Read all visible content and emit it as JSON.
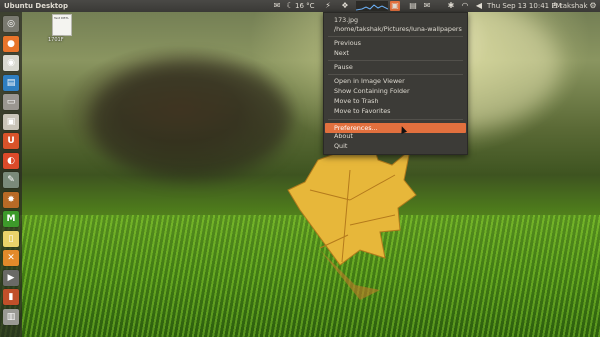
{
  "panel": {
    "title": "Ubuntu Desktop",
    "weather": "16 °C",
    "clock": "Thu Sep 13 10:41 PM",
    "user": "takshak",
    "icons": [
      "mail-icon",
      "cloud-icon",
      "lightning-icon",
      "dropbox-icon",
      "network-monitor-icon",
      "wallpaper-changer-icon",
      "chat-icon",
      "messaging-icon",
      "wifi-icon",
      "volume-icon",
      "settings-icon"
    ]
  },
  "launcher": {
    "items": [
      {
        "name": "dash-home-icon",
        "glyph": "◎",
        "color": "#7a7a70"
      },
      {
        "name": "firefox-icon",
        "glyph": "●",
        "color": "#e8742a"
      },
      {
        "name": "chromium-icon",
        "glyph": "◉",
        "color": "#d9d9d0"
      },
      {
        "name": "libreoffice-writer-icon",
        "glyph": "▤",
        "color": "#2f7fc1"
      },
      {
        "name": "files-icon",
        "glyph": "▭",
        "color": "#9a9690"
      },
      {
        "name": "image-viewer-icon",
        "glyph": "▣",
        "color": "#c9c4b8"
      },
      {
        "name": "ubuntu-one-icon",
        "glyph": "U",
        "color": "#d9532a"
      },
      {
        "name": "software-center-icon",
        "glyph": "◐",
        "color": "#dc4a2a"
      },
      {
        "name": "system-tool-icon",
        "glyph": "✎",
        "color": "#7a8a7a"
      },
      {
        "name": "game-icon",
        "glyph": "✸",
        "color": "#b86a26"
      },
      {
        "name": "mcdonalds-app-icon",
        "glyph": "M",
        "color": "#3d9a2a"
      },
      {
        "name": "notes-icon",
        "glyph": "▯",
        "color": "#e9d36a"
      },
      {
        "name": "tools-icon",
        "glyph": "✕",
        "color": "#e28a2a"
      },
      {
        "name": "media-icon",
        "glyph": "▶",
        "color": "#6a6a66"
      },
      {
        "name": "terminal-icon",
        "glyph": "▮",
        "color": "#c0502a"
      },
      {
        "name": "trash-icon",
        "glyph": "▥",
        "color": "#9a9a94"
      }
    ]
  },
  "desktop": {
    "file_label": "1701F",
    "file_text": "Text\nDBTL"
  },
  "menu": {
    "filename": "173.jpg",
    "path": "/home/takshak/Pictures/luna-wallpapers",
    "previous": "Previous",
    "next": "Next",
    "pause": "Pause",
    "open_in_viewer": "Open in Image Viewer",
    "show_folder": "Show Containing Folder",
    "move_trash": "Move to Trash",
    "move_favorites": "Move to Favorites",
    "preferences": "Preferences...",
    "about": "About",
    "quit": "Quit"
  },
  "colors": {
    "highlight": "#e2703e",
    "panel": "#3c3b37"
  }
}
